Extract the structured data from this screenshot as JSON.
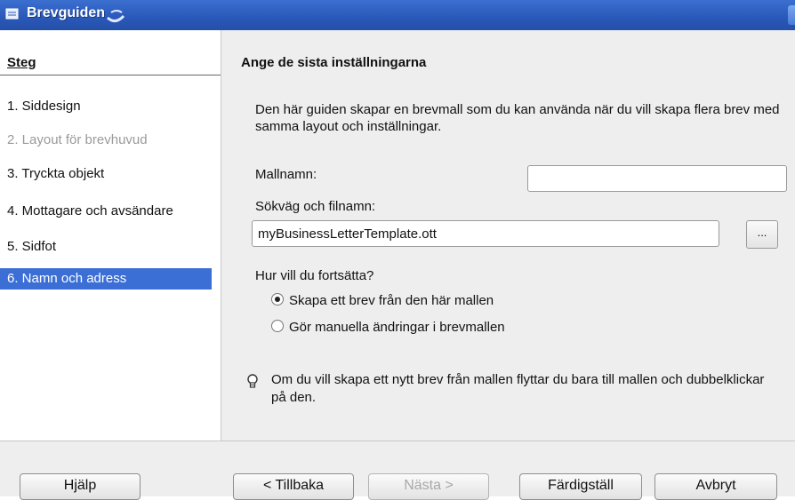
{
  "window": {
    "title": "Brevguiden"
  },
  "steps": {
    "header": "Steg",
    "items": [
      {
        "label": "1. Siddesign"
      },
      {
        "label": "2. Layout för brevhuvud"
      },
      {
        "label": "3. Tryckta objekt"
      },
      {
        "label": "4. Mottagare och avsändare"
      },
      {
        "label": "5. Sidfot"
      },
      {
        "label": "6. Namn och adress"
      }
    ]
  },
  "main": {
    "title": "Ange de sista inställningarna",
    "description": "Den här guiden skapar en brevmall som du kan använda när du vill skapa flera brev med samma layout och inställningar.",
    "template_name_label": "Mallnamn:",
    "template_name_value": "",
    "path_label": "Sökväg och filnamn:",
    "path_value": "myBusinessLetterTemplate.ott",
    "browse_label": "...",
    "continue_question": "Hur vill du fortsätta?",
    "options": [
      {
        "label": "Skapa ett brev från den här mallen",
        "selected": true
      },
      {
        "label": "Gör manuella ändringar i brevmallen",
        "selected": false
      }
    ],
    "hint_icon": "lightbulb-icon",
    "hint": "Om du vill skapa ett nytt brev från mallen flyttar du bara till mallen och dubbelklickar på den."
  },
  "buttons": {
    "help": "Hjälp",
    "back": "< Tillbaka",
    "next": "Nästa >",
    "finish": "Färdigställ",
    "cancel": "Avbryt"
  },
  "colors": {
    "titlebar": "#2a58b8",
    "selection": "#3b6fd6",
    "panel": "#eeeeee"
  }
}
